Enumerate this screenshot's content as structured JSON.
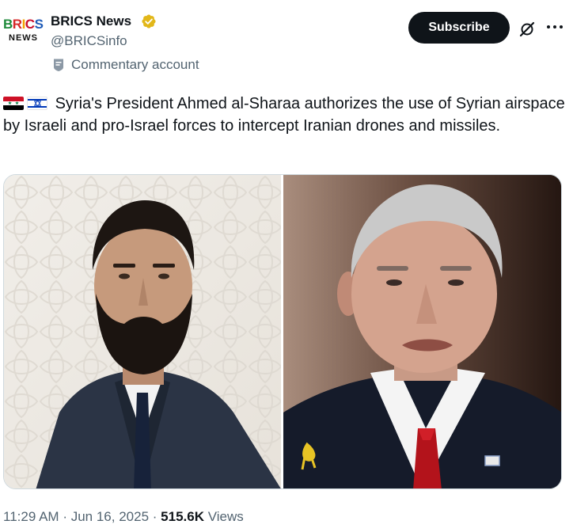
{
  "account": {
    "avatar_line1": "BRICS",
    "avatar_line2": "NEWS",
    "name": "BRICS News",
    "handle": "@BRICSinfo",
    "label": "Commentary account"
  },
  "actions": {
    "subscribe_label": "Subscribe",
    "grok_icon": "grok-icon",
    "more_icon": "more-icon"
  },
  "tweet": {
    "flags": [
      "syria-flag-icon",
      "israel-flag-icon"
    ],
    "text": "Syria's President Ahmed al-Sharaa authorizes the use of Syrian airspace by Israeli and pro-Israel forces to intercept Iranian drones and missiles."
  },
  "meta": {
    "time": "11:29 AM",
    "separator": "·",
    "date": "Jun 16, 2025",
    "views_count": "515.6K",
    "views_label": "Views"
  },
  "colors": {
    "text_primary": "#0f1419",
    "text_secondary": "#536471",
    "verified_gold": "#e2b719",
    "subscribe_bg": "#0f1419"
  }
}
